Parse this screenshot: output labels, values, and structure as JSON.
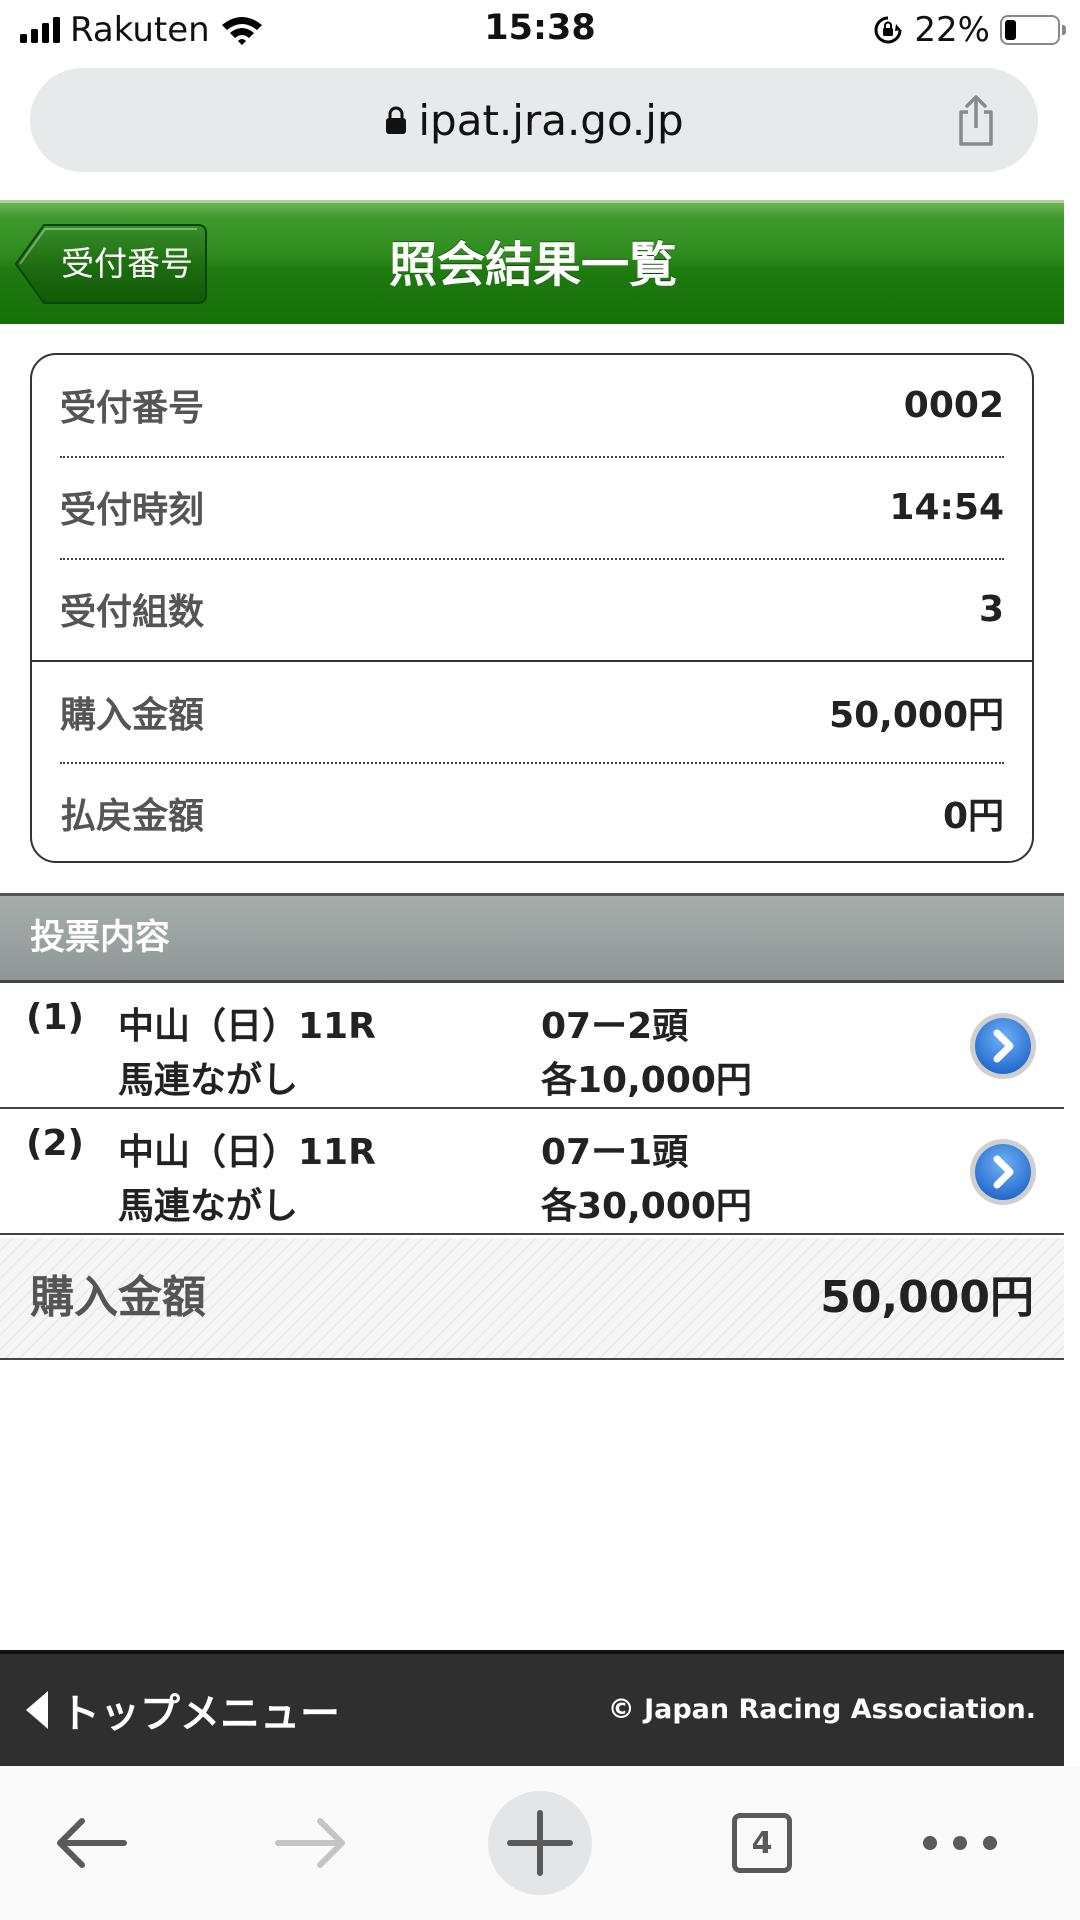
{
  "status_bar": {
    "carrier": "Rakuten",
    "time": "15:38",
    "battery_percent": "22%",
    "battery_level": 0.22
  },
  "browser": {
    "url": "ipat.jra.go.jp",
    "tab_count": "4"
  },
  "header": {
    "back_label": "受付番号",
    "title": "照会結果一覧",
    "color": "#2d8a1c"
  },
  "receipt": {
    "rows": [
      {
        "label": "受付番号",
        "value": "0002"
      },
      {
        "label": "受付時刻",
        "value": "14:54"
      },
      {
        "label": "受付組数",
        "value": "3"
      },
      {
        "label": "購入金額",
        "value": "50,000円"
      },
      {
        "label": "払戻金額",
        "value": "0円"
      }
    ]
  },
  "bets": {
    "section_title": "投票内容",
    "items": [
      {
        "num": "(1)",
        "race": "中山（日）11R",
        "type": "馬連ながし",
        "combo": "07ー2頭",
        "amount": "各10,000円"
      },
      {
        "num": "(2)",
        "race": "中山（日）11R",
        "type": "馬連ながし",
        "combo": "07ー1頭",
        "amount": "各30,000円"
      }
    ]
  },
  "total": {
    "label": "購入金額",
    "value": "50,000円"
  },
  "footer": {
    "top_menu": "トップメニュー",
    "copyright": "© Japan Racing Association."
  },
  "icons": {
    "back": "arrow-left-icon",
    "forward": "arrow-right-icon",
    "new_tab": "plus-icon",
    "tabs": "tabs-icon",
    "more": "ellipsis-icon",
    "share": "share-icon",
    "detail": "chevron-right-circle-icon"
  }
}
